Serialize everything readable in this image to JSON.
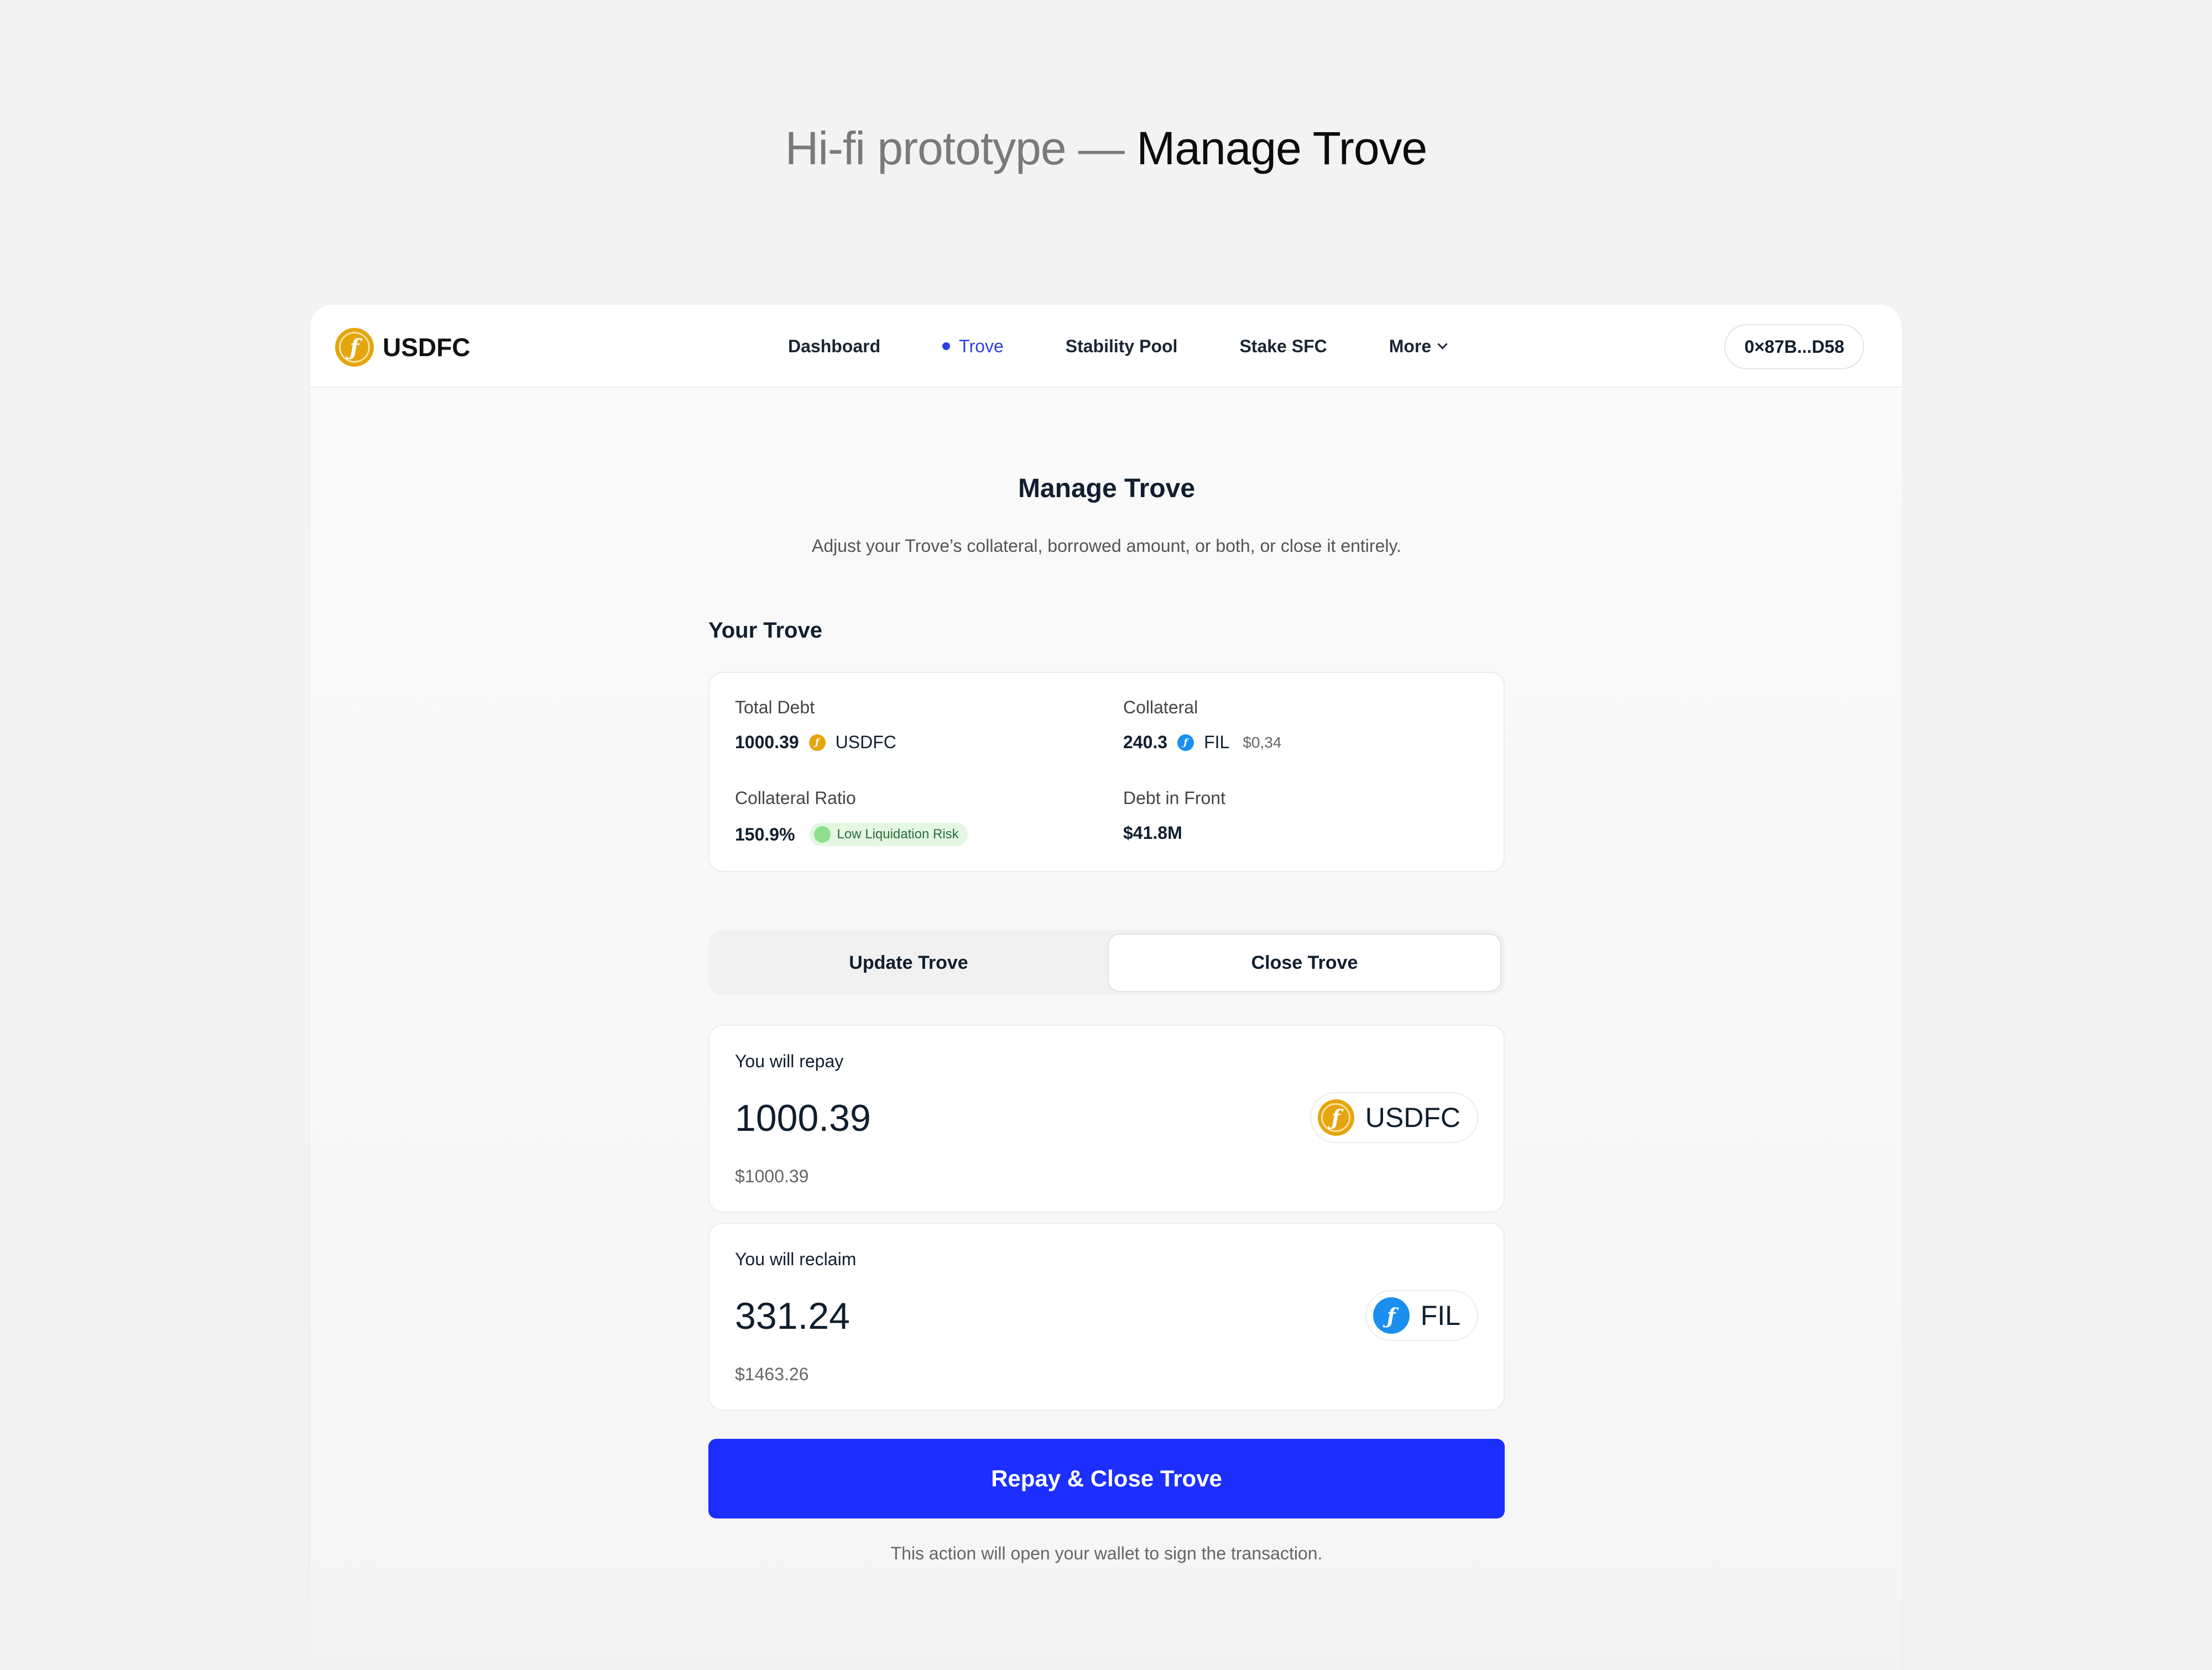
{
  "hero": {
    "prefix": "Hi-fi prototype —",
    "title": "Manage Trove"
  },
  "brand": {
    "name": "USDFC",
    "icon": "usdfc-coin-icon",
    "color": "#e5a50f"
  },
  "nav": {
    "items": [
      {
        "label": "Dashboard",
        "active": false
      },
      {
        "label": "Trove",
        "active": true
      },
      {
        "label": "Stability Pool",
        "active": false
      },
      {
        "label": "Stake SFC",
        "active": false
      },
      {
        "label": "More",
        "active": false
      }
    ],
    "wallet": "0×87B...D58"
  },
  "page": {
    "title": "Manage Trove",
    "subtitle": "Adjust your Trove’s collateral, borrowed amount, or both, or close it entirely.",
    "section_title": "Your Trove"
  },
  "summary": {
    "total_debt": {
      "label": "Total Debt",
      "value": "1000.39",
      "unit": "USDFC"
    },
    "collateral": {
      "label": "Collateral",
      "value": "240.3",
      "unit": "FIL",
      "price": "$0,34"
    },
    "ratio": {
      "label": "Collateral Ratio",
      "value": "150.9%",
      "badge": "Low Liquidation Risk"
    },
    "debt_in_front": {
      "label": "Debt in Front",
      "value": "$41.8M"
    }
  },
  "tabs": {
    "update": "Update Trove",
    "close": "Close Trove",
    "selected": "Close Trove"
  },
  "repay": {
    "label": "You will repay",
    "amount": "1000.39",
    "usd": "$1000.39",
    "token": "USDFC"
  },
  "reclaim": {
    "label": "You will reclaim",
    "amount": "331.24",
    "usd": "$1463.26",
    "token": "FIL"
  },
  "cta": {
    "label": "Repay & Close Trove",
    "color": "#1c2ffe"
  },
  "footnote": "This action will open your wallet to sign the transaction.",
  "colors": {
    "accent": "#2d3fe0",
    "fil": "#1a8ff0",
    "badge_bg": "#e3f7e3"
  }
}
